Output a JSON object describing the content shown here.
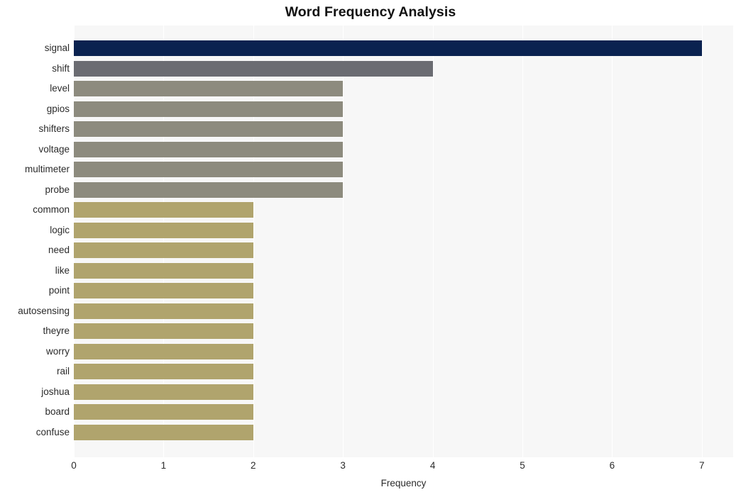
{
  "chart_data": {
    "type": "bar",
    "orientation": "horizontal",
    "title": "Word Frequency Analysis",
    "xlabel": "Frequency",
    "ylabel": "",
    "xlim": [
      0,
      7.35
    ],
    "xticks": [
      0,
      1,
      2,
      3,
      4,
      5,
      6,
      7
    ],
    "xtick_labels": [
      "0",
      "1",
      "2",
      "3",
      "4",
      "5",
      "6",
      "7"
    ],
    "grid": true,
    "grid_axis": "x",
    "legend": false,
    "categories": [
      "signal",
      "shift",
      "level",
      "gpios",
      "shifters",
      "voltage",
      "multimeter",
      "probe",
      "common",
      "logic",
      "need",
      "like",
      "point",
      "autosensing",
      "theyre",
      "worry",
      "rail",
      "joshua",
      "board",
      "confuse"
    ],
    "values": [
      7,
      4,
      3,
      3,
      3,
      3,
      3,
      3,
      2,
      2,
      2,
      2,
      2,
      2,
      2,
      2,
      2,
      2,
      2,
      2
    ],
    "bar_colors": [
      "#0a2250",
      "#6b6c72",
      "#8d8b7e",
      "#8d8b7e",
      "#8d8b7e",
      "#8d8b7e",
      "#8d8b7e",
      "#8d8b7e",
      "#b0a46d",
      "#b0a46d",
      "#b0a46d",
      "#b0a46d",
      "#b0a46d",
      "#b0a46d",
      "#b0a46d",
      "#b0a46d",
      "#b0a46d",
      "#b0a46d",
      "#b0a46d",
      "#b0a46d"
    ]
  },
  "style": {
    "figure_background": "#ffffff",
    "plot_background": "#f7f7f7",
    "gridline_color": "#ffffff",
    "text_color": "#2b2b2b",
    "title_color": "#111111"
  }
}
